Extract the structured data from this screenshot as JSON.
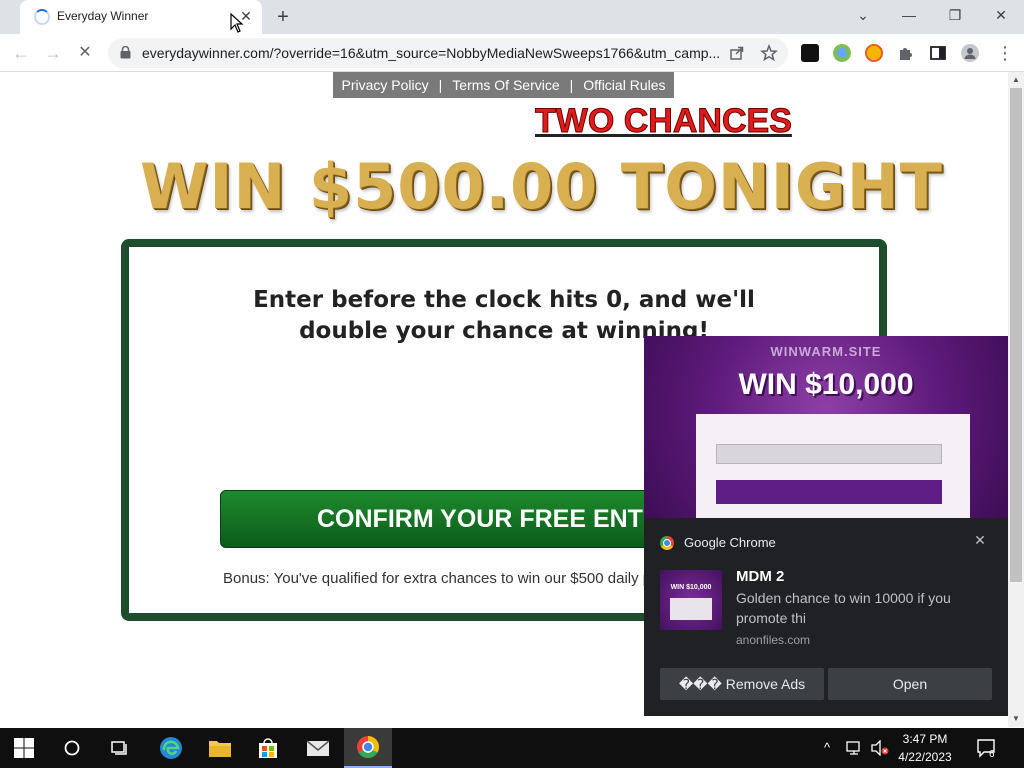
{
  "browser": {
    "tab_title": "Everyday Winner",
    "tab_close_glyph": "✕",
    "new_tab_glyph": "+",
    "url": "everydaywinner.com/?override=16&utm_source=NobbyMediaNewSweeps1766&utm_camp...",
    "window_controls": {
      "tab_search": "⌄",
      "minimize": "—",
      "restore": "❐",
      "close": "✕"
    },
    "nav": {
      "back": "←",
      "forward": "→",
      "stop": "✕"
    }
  },
  "page": {
    "legal_links": [
      "Privacy Policy",
      "Terms Of Service",
      "Official Rules"
    ],
    "separator": "|",
    "two_chances": "TWO CHANCES",
    "headline": "WIN $500.00 TONIGHT",
    "card_text_line1": "Enter before the clock hits 0, and we'll",
    "card_text_line2": "double your chance at winning!",
    "confirm_button": "CONFIRM YOUR FREE ENTRY",
    "bonus_text": "Bonus: You've qualified for extra chances to win our $500 daily prize!"
  },
  "notification": {
    "image_site": "WINWARM.SITE",
    "image_headline": "WIN $10,000",
    "thumb_text": "WIN $10,000",
    "app_name": "Google Chrome",
    "title": "MDM 2",
    "body": "Golden chance to win 10000 if you promote thi",
    "source": "anonfiles.com",
    "button_remove": "��� Remove Ads",
    "button_open": "Open",
    "close_glyph": "✕"
  },
  "taskbar": {
    "time": "3:47 PM",
    "date": "4/22/2023",
    "notification_count": "6",
    "tray_chevron": "^"
  },
  "colors": {
    "tabstrip": "#dee1e6",
    "card_border": "#1f4e2f",
    "confirm_green": "#0c5c19",
    "two_chances_red": "#e01b1b",
    "headline_gold": "#d8b052",
    "notification_bg": "#202124",
    "taskbar": "#0f0f0f"
  },
  "icons": [
    "loading-spinner-icon",
    "close-icon",
    "plus-icon",
    "chevron-down-icon",
    "minimize-icon",
    "restore-icon",
    "back-arrow-icon",
    "forward-arrow-icon",
    "stop-icon",
    "lock-icon",
    "share-icon",
    "star-icon",
    "extension-icon",
    "puzzle-icon",
    "side-panel-icon",
    "profile-icon",
    "menu-dots-icon",
    "chrome-icon",
    "windows-start-icon",
    "search-circle-icon",
    "task-view-icon",
    "edge-icon",
    "file-explorer-icon",
    "store-icon",
    "mail-icon",
    "network-icon",
    "volume-muted-icon",
    "action-center-icon"
  ]
}
